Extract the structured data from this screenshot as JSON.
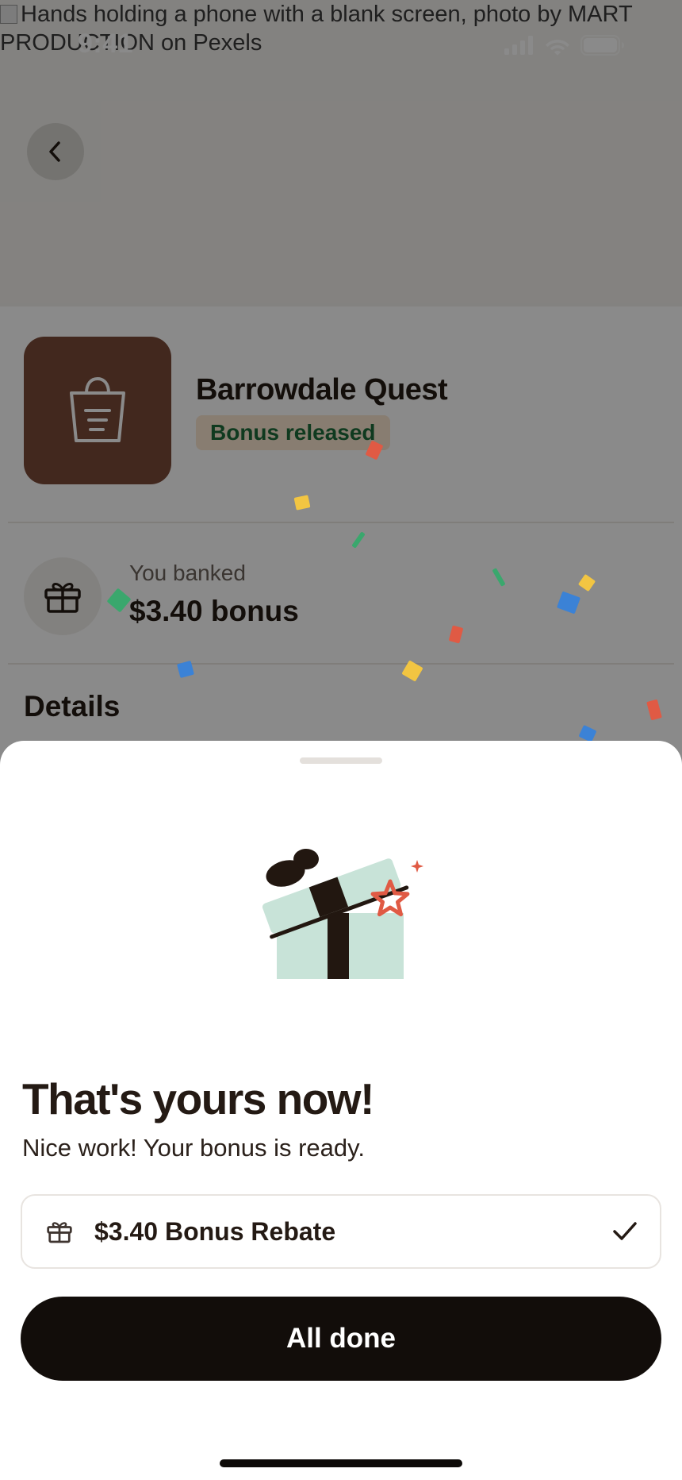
{
  "status_bar": {
    "time": "9:41"
  },
  "hero": {
    "image_alt": "Hands holding a phone with a blank screen, photo by MART PRODUCTION on Pexels"
  },
  "back_icon": "chevron-left-icon",
  "app": {
    "title": "Barrowdale Quest",
    "badge": "Bonus released",
    "icon": "shopping-bag-icon",
    "icon_bg": "#7a4a38"
  },
  "banked": {
    "label": "You banked",
    "value": "$3.40 bonus"
  },
  "details": {
    "heading": "Details"
  },
  "sheet": {
    "title": "That's yours now!",
    "subtitle": "Nice work! Your bonus is ready.",
    "reward_label": "$3.40 Bonus Rebate",
    "reward_icon": "gift-icon",
    "reward_status_icon": "check-icon",
    "primary_button": "All done"
  },
  "colors": {
    "badge_bg": "#fbe7d1",
    "badge_text": "#1c6b3a",
    "button_bg": "#120d0a",
    "gift_box": "#c8e3d8",
    "gift_ribbon": "#221710",
    "star": "#e05a44",
    "confetti": [
      "#e05a44",
      "#f2c542",
      "#3aa76d",
      "#3b82d6"
    ]
  }
}
